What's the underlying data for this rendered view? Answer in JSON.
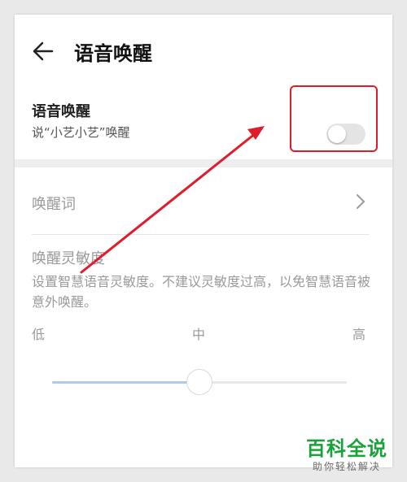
{
  "header": {
    "title": "语音唤醒",
    "back_icon": "back-arrow-icon"
  },
  "voice_wakeup": {
    "title": "语音唤醒",
    "subtitle": "说“小艺小艺”唤醒",
    "toggle_on": false
  },
  "wake_word": {
    "label": "唤醒词",
    "chevron_icon": "chevron-right-icon"
  },
  "sensitivity": {
    "title": "唤醒灵敏度",
    "description": "设置智慧语音灵敏度。不建议灵敏度过高，以免智慧语音被意外唤醒。",
    "ticks": {
      "low": "低",
      "mid": "中",
      "high": "高"
    },
    "value": 0.5
  },
  "annotation": {
    "highlight_color": "#e01c2c",
    "arrow_color": "#e01c2c"
  },
  "watermark": {
    "main": "百科全说",
    "sub": "助你轻松解决"
  },
  "colors": {
    "accent_fill": "#a9cdea",
    "toggle_off": "#e4e4e4"
  }
}
